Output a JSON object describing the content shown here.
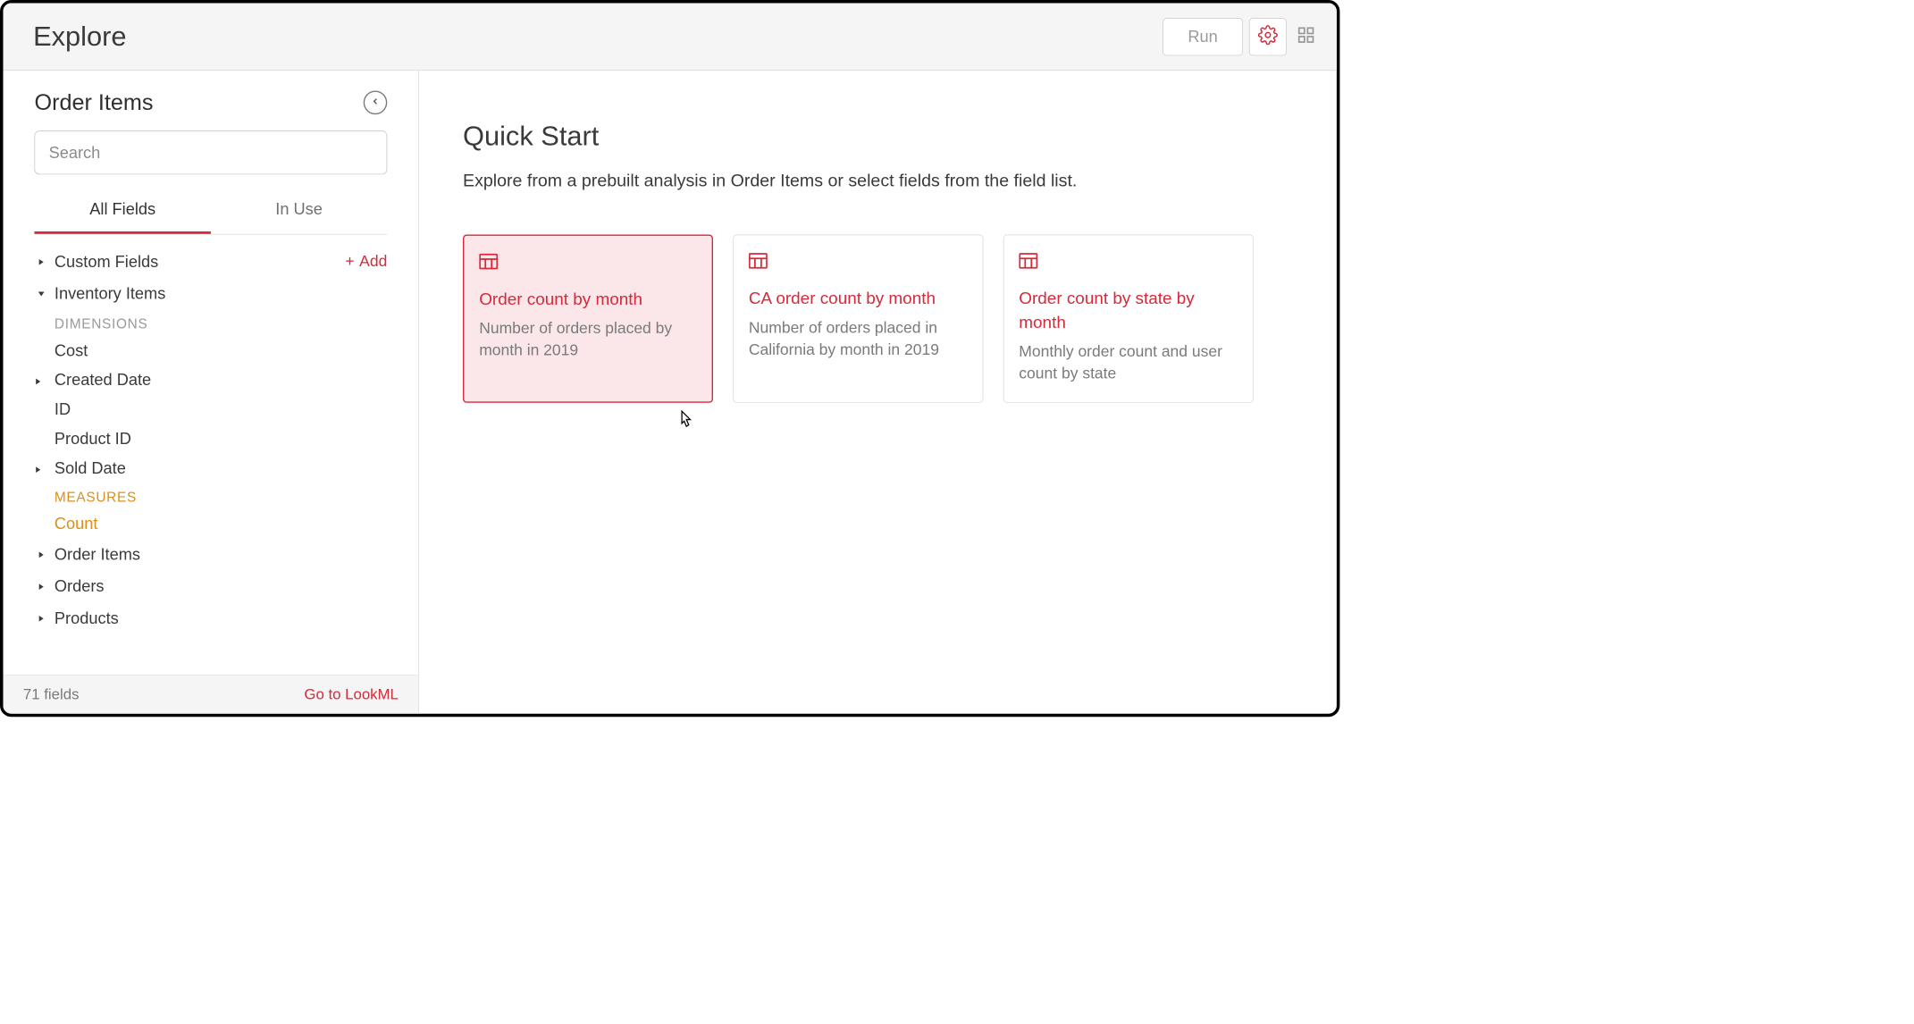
{
  "header": {
    "title": "Explore",
    "run_label": "Run"
  },
  "sidebar": {
    "title": "Order Items",
    "search_placeholder": "Search",
    "tabs": {
      "all": "All Fields",
      "in_use": "In Use"
    },
    "custom_fields": "Custom Fields",
    "add_label": "Add",
    "inventory_items": "Inventory Items",
    "dimensions_label": "DIMENSIONS",
    "fields": {
      "cost": "Cost",
      "created_date": "Created Date",
      "id": "ID",
      "product_id": "Product ID",
      "sold_date": "Sold Date"
    },
    "measures_label": "MEASURES",
    "measures": {
      "count": "Count"
    },
    "groups": {
      "order_items": "Order Items",
      "orders": "Orders",
      "products": "Products"
    },
    "footer": {
      "count": "71 fields",
      "lookml": "Go to LookML"
    }
  },
  "main": {
    "title": "Quick Start",
    "description": "Explore from a prebuilt analysis in Order Items or select fields from the field list.",
    "cards": [
      {
        "title": "Order count by month",
        "desc": "Number of orders placed by month in 2019"
      },
      {
        "title": "CA order count by month",
        "desc": "Number of orders placed in California by month in 2019"
      },
      {
        "title": "Order count by state by month",
        "desc": "Monthly order count and user count by state"
      }
    ]
  }
}
